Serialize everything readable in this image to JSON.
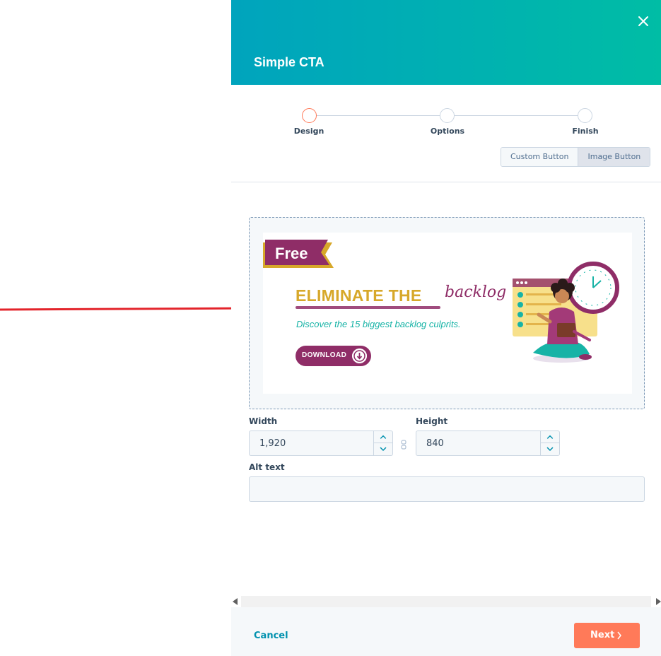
{
  "modal": {
    "title": "Simple CTA"
  },
  "stepper": {
    "steps": [
      {
        "label": "Design",
        "state": "active"
      },
      {
        "label": "Options",
        "state": "inactive"
      },
      {
        "label": "Finish",
        "state": "inactive"
      }
    ]
  },
  "button_type": {
    "options": [
      "Custom Button",
      "Image Button"
    ],
    "selected": "Image Button"
  },
  "preview": {
    "tag": "Free",
    "headline": "ELIMINATE THE",
    "headline_script": "backlog",
    "subline": "Discover the 15 biggest backlog culprits.",
    "cta": "DOWNLOAD"
  },
  "fields": {
    "width_label": "Width",
    "width_value": "1,920",
    "height_label": "Height",
    "height_value": "840",
    "alt_label": "Alt text",
    "alt_value": ""
  },
  "footer": {
    "cancel_label": "Cancel",
    "next_label": "Next"
  },
  "icons": {
    "close": "close-icon",
    "link": "link-icon",
    "chevron_up": "chevron-up-icon",
    "chevron_down": "chevron-down-icon",
    "chevron_right": "chevron-right-icon",
    "download": "arrow-down-icon"
  },
  "colors": {
    "header_start": "#00a4bd",
    "header_end": "#00bda5",
    "accent": "#ff7a59",
    "link": "#0091ae",
    "arrow": "#e3242b",
    "brand_purple": "#8f2d67",
    "brand_gold": "#d7a82a",
    "brand_teal": "#17b3a6"
  }
}
